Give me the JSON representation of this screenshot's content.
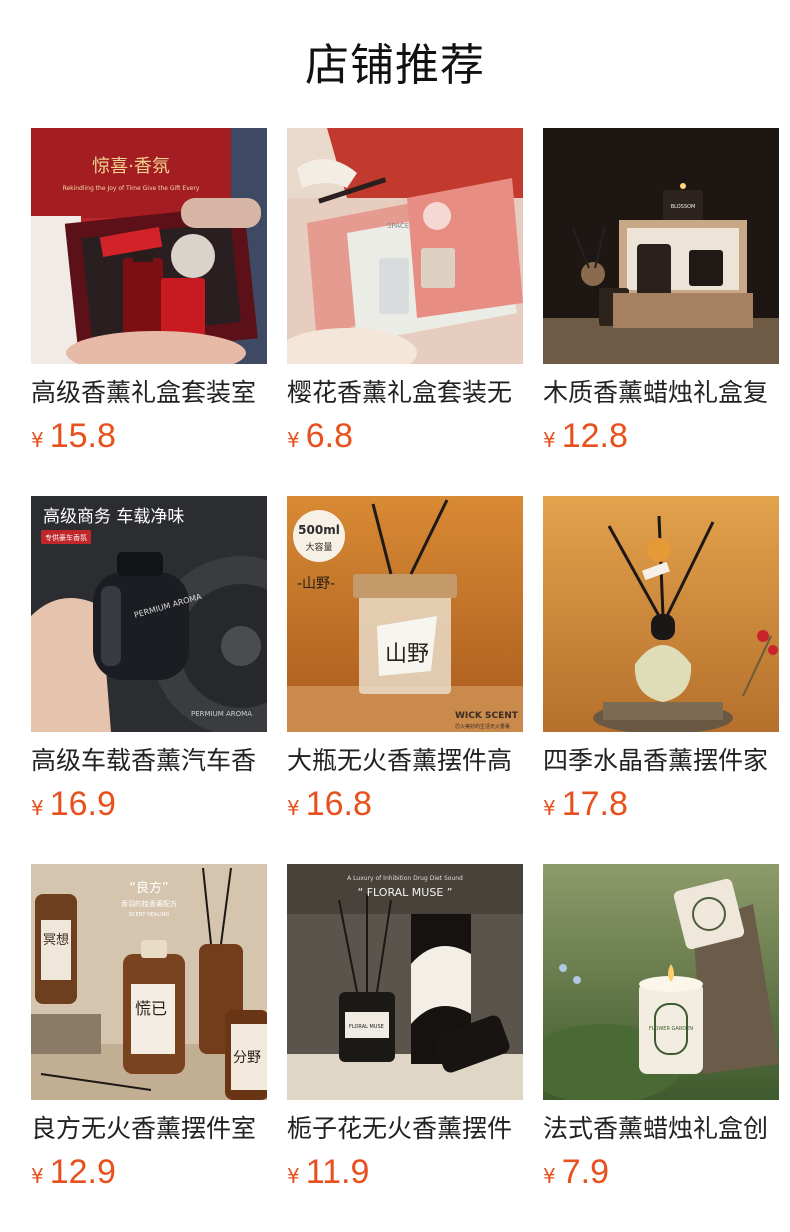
{
  "section_title": "店铺推荐",
  "currency": "¥",
  "products": [
    {
      "name": "高级香薰礼盒套装室",
      "price": "15.8",
      "image": "gift-box-red-image",
      "overlay": {
        "title": "惊喜·香氛",
        "sub": "Rekindling the Joy of Time Give the Gift Every"
      }
    },
    {
      "name": "樱花香薰礼盒套装无",
      "price": "6.8",
      "image": "gift-box-pink-image",
      "overlay": {
        "tag": "SPACE"
      }
    },
    {
      "name": "木质香薰蜡烛礼盒复",
      "price": "12.8",
      "image": "wooden-candle-box-image",
      "overlay": {
        "brand": "BLOSSOM"
      }
    },
    {
      "name": "高级车载香薰汽车香",
      "price": "16.9",
      "image": "car-aroma-bottle-image",
      "overlay": {
        "title": "高级商务 车载净味",
        "badge": "专供豪车香氛",
        "bottle": "PERMIUM AROMA",
        "footer": "PERMIUM AROMA"
      }
    },
    {
      "name": "大瓶无火香薰摆件高",
      "price": "16.8",
      "image": "reed-diffuser-large-image",
      "overlay": {
        "bubble_top": "500ml",
        "bubble_bottom": "大容量",
        "label": "-山野-",
        "brand": "WICK SCENT",
        "sub": "芯火美妙的生活无火香薰",
        "glass": "山野"
      }
    },
    {
      "name": "四季水晶香薰摆件家",
      "price": "17.8",
      "image": "crystal-diffuser-image",
      "overlay": {}
    },
    {
      "name": "良方无火香薰摆件室",
      "price": "12.9",
      "image": "liangfang-bottles-image",
      "overlay": {
        "title": "“良方”",
        "sub": "香羽的桂香薰配方",
        "eng": "SCENT HEALING",
        "b1": "冥想",
        "b2": "慌已",
        "b3": "分野"
      }
    },
    {
      "name": "栀子花无火香薰摆件",
      "price": "11.9",
      "image": "floral-muse-image",
      "overlay": {
        "top": "A Luxury of Inhibition Drug Diet Sound",
        "title": "“ FLORAL MUSE ”",
        "label": "FLORAL MUSE"
      }
    },
    {
      "name": "法式香薰蜡烛礼盒创",
      "price": "7.9",
      "image": "french-candle-image",
      "overlay": {
        "label": "FLOWER GARDEN"
      }
    }
  ]
}
